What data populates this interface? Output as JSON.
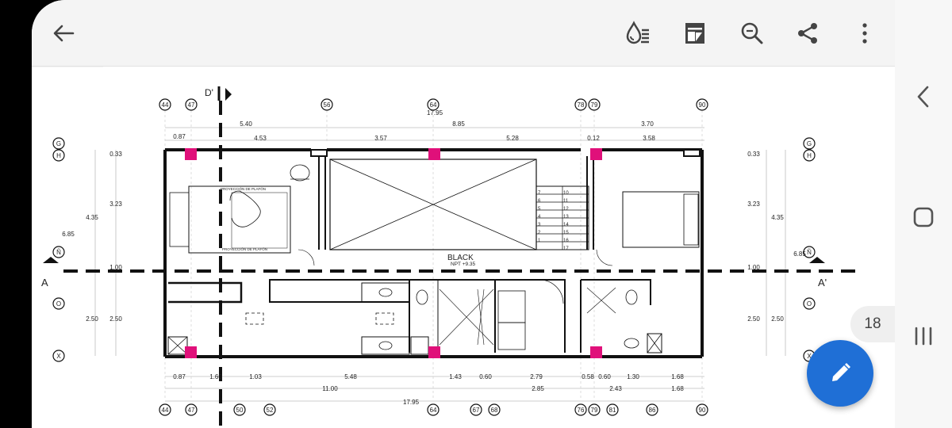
{
  "appbar": {
    "back_icon": "arrow-left-icon",
    "ink_icon": "ink-drop-icon",
    "page_icon": "page-layout-icon",
    "zoom_icon": "zoom-search-icon",
    "share_icon": "share-icon",
    "more_icon": "more-vert-icon"
  },
  "navbar": {
    "back_icon": "chevron-left-icon",
    "home_icon": "home-square-icon",
    "recent_icon": "recent-apps-icon"
  },
  "page_indicator": "18",
  "fab_icon": "pencil-icon",
  "accent_color": "#1f6fd6",
  "plan": {
    "section_top": "D'",
    "section_left": "A",
    "section_right": "A'",
    "room_label": "BLACK",
    "level_label": "NPT +9.35",
    "ceiling_note": "PROYECCIÓN DE PLAFÓN",
    "top_axes": [
      "44",
      "47",
      "56",
      "64",
      "78",
      "79",
      "90"
    ],
    "bottom_axes": [
      "44",
      "47",
      "50",
      "52",
      "64",
      "67",
      "68",
      "76",
      "79",
      "81",
      "86",
      "90"
    ],
    "left_axes": [
      "G",
      "H",
      "Ñ",
      "O",
      "X"
    ],
    "right_axes": [
      "G",
      "H",
      "Ñ",
      "O",
      "X"
    ],
    "dim_top_total": "17.95",
    "dim_top_row2": [
      "0.87",
      "5.40",
      "8.85",
      "3.70"
    ],
    "dim_top_row3": [
      "4.53",
      "3.57",
      "5.28",
      "0.12",
      "3.58"
    ],
    "dim_bottom_row1": [
      "0.87",
      "1.60",
      "1.03",
      "5.48",
      "1.43",
      "0.60",
      "2.79",
      "0.58",
      "0.60",
      "1.30",
      "1.68"
    ],
    "dim_bottom_row2": [
      "11.00",
      "2.85",
      "2.43",
      "1.68"
    ],
    "dim_bottom_total": "17.95",
    "dim_left": [
      "0.33",
      "3.23",
      "4.35",
      "6.85",
      "1.00",
      "2.50",
      "2.50"
    ],
    "dim_right": [
      "0.33",
      "3.23",
      "4.35",
      "6.85",
      "1.00",
      "2.50",
      "2.50"
    ],
    "stair_left": [
      "7",
      "6",
      "5",
      "4",
      "3",
      "2",
      "1"
    ],
    "stair_right": [
      "10",
      "11",
      "12",
      "13",
      "14",
      "15",
      "16",
      "17"
    ]
  }
}
